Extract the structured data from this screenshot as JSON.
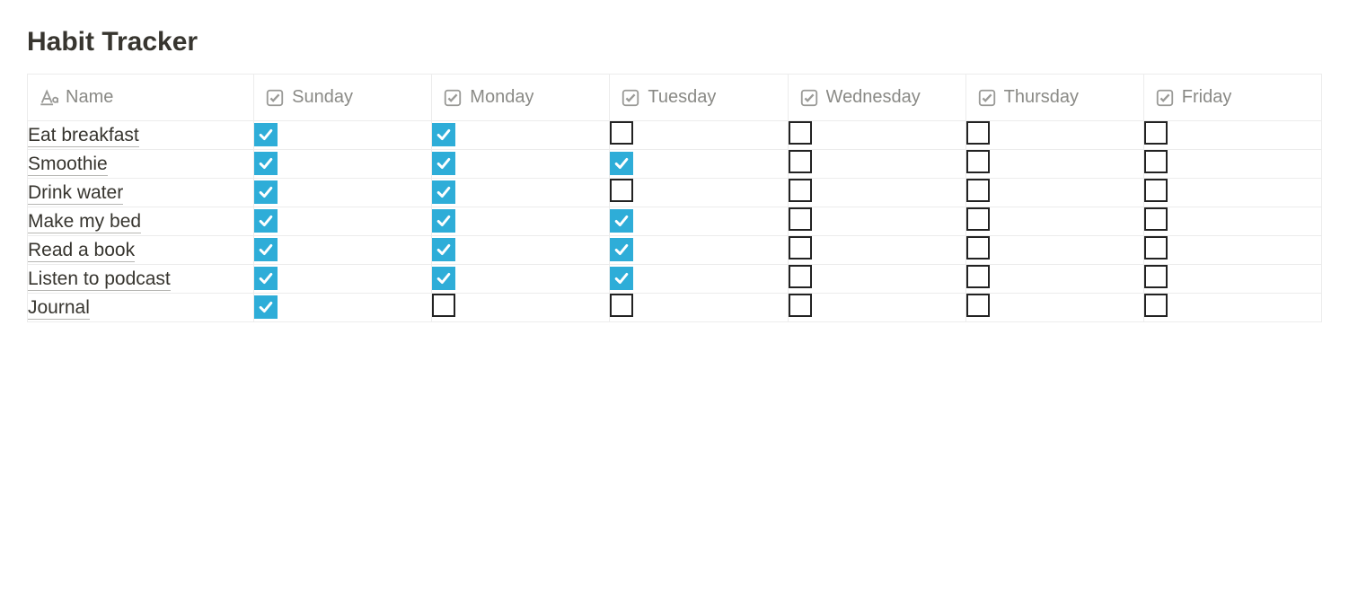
{
  "title": "Habit Tracker",
  "columns": {
    "name": "Name",
    "days": [
      "Sunday",
      "Monday",
      "Tuesday",
      "Wednesday",
      "Thursday",
      "Friday"
    ]
  },
  "rows": [
    {
      "name": "Eat breakfast",
      "checks": [
        true,
        true,
        false,
        false,
        false,
        false
      ]
    },
    {
      "name": "Smoothie",
      "checks": [
        true,
        true,
        true,
        false,
        false,
        false
      ]
    },
    {
      "name": "Drink water",
      "checks": [
        true,
        true,
        false,
        false,
        false,
        false
      ]
    },
    {
      "name": "Make my bed",
      "checks": [
        true,
        true,
        true,
        false,
        false,
        false
      ]
    },
    {
      "name": "Read a book",
      "checks": [
        true,
        true,
        true,
        false,
        false,
        false
      ]
    },
    {
      "name": "Listen to podcast",
      "checks": [
        true,
        true,
        true,
        false,
        false,
        false
      ]
    },
    {
      "name": "Journal",
      "checks": [
        true,
        false,
        false,
        false,
        false,
        false
      ]
    }
  ]
}
